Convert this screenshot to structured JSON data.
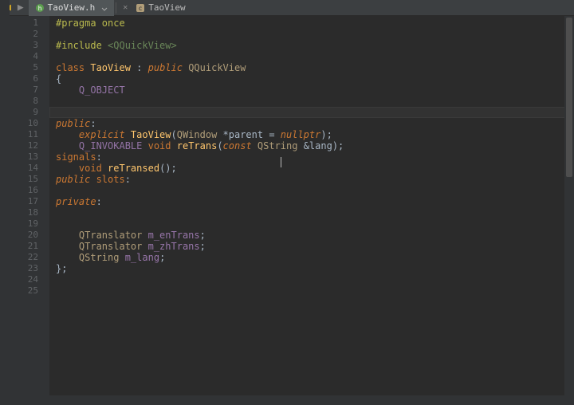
{
  "tabs": {
    "file": "TaoView.h",
    "breadcrumb": "TaoView"
  },
  "code": {
    "l1": {
      "pre": "#pragma once"
    },
    "l3a": {
      "pre": "#include "
    },
    "l3b": {
      "str": "<QQuickView>"
    },
    "l5": {
      "kw_class": "class",
      "name": "TaoView",
      "colon": " : ",
      "kw_pub": "public",
      "base": " QQuickView"
    },
    "l6": {
      "brace": "{"
    },
    "l7": {
      "macro": "Q_OBJECT"
    },
    "l10": {
      "kw": "public",
      "colon": ":"
    },
    "l11": {
      "kw_explicit": "explicit",
      "ctor": " TaoView",
      "open": "(",
      "ptype": "QWindow ",
      "star": "*parent = ",
      "null": "nullptr",
      "close": ");"
    },
    "l12": {
      "macro": "Q_INVOKABLE ",
      "kw_void": "void",
      "fn": " reTrans",
      "open": "(",
      "kw_const": "const",
      "ptype": " QString ",
      "ref": "&lang",
      "close": ");"
    },
    "l13": {
      "kw": "signals",
      "colon": ":"
    },
    "l14": {
      "kw_void": "void",
      "fn": " reTransed",
      "rest": "();"
    },
    "l15": {
      "kw1": "public",
      "kw2": " slots",
      "colon": ":"
    },
    "l17": {
      "kw": "private",
      "colon": ":"
    },
    "l20": {
      "type": "QTranslator ",
      "var": "m_enTrans",
      "semi": ";"
    },
    "l21": {
      "type": "QTranslator ",
      "var": "m_zhTrans",
      "semi": ";"
    },
    "l22": {
      "type": "QString ",
      "var": "m_lang",
      "semi": ";"
    },
    "l23": {
      "brace": "};"
    }
  },
  "line_numbers": [
    "1",
    "2",
    "3",
    "4",
    "5",
    "6",
    "7",
    "8",
    "9",
    "10",
    "11",
    "12",
    "13",
    "14",
    "15",
    "16",
    "17",
    "18",
    "19",
    "20",
    "21",
    "22",
    "23",
    "24",
    "25"
  ]
}
